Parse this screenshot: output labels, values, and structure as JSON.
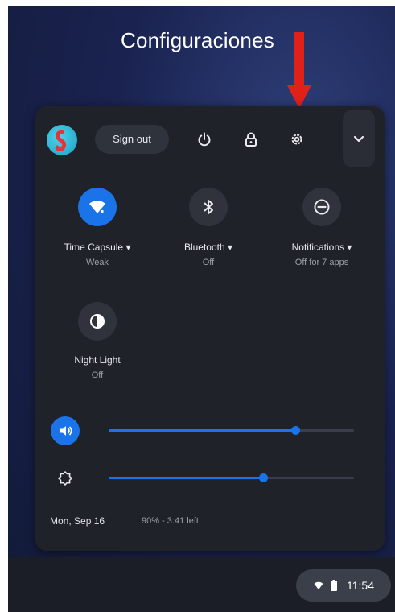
{
  "caption": "Configuraciones",
  "header": {
    "sign_out_label": "Sign out",
    "icons": [
      "power-icon",
      "lock-icon",
      "settings-icon",
      "chevron-down-icon"
    ]
  },
  "tiles": [
    {
      "label": "Time Capsule",
      "sublabel": "Weak",
      "icon": "wifi-icon",
      "active": true
    },
    {
      "label": "Bluetooth",
      "sublabel": "Off",
      "icon": "bluetooth-icon",
      "active": false
    },
    {
      "label": "Notifications",
      "sublabel": "Off for 7 apps",
      "icon": "do-not-disturb-icon",
      "active": false
    },
    {
      "label": "Night Light",
      "sublabel": "Off",
      "icon": "night-light-icon",
      "active": false
    }
  ],
  "sliders": {
    "volume": {
      "icon": "volume-icon",
      "level_percent": 76
    },
    "brightness": {
      "icon": "brightness-icon",
      "level_percent": 63
    }
  },
  "footer": {
    "date": "Mon, Sep 16",
    "battery": "90% - 3:41 left"
  },
  "tray": {
    "time": "11:54",
    "icons": [
      "wifi-icon",
      "battery-icon"
    ]
  },
  "colors": {
    "accent": "#1a73e8",
    "panel": "#20222a",
    "annotation_arrow": "#e0211a"
  }
}
